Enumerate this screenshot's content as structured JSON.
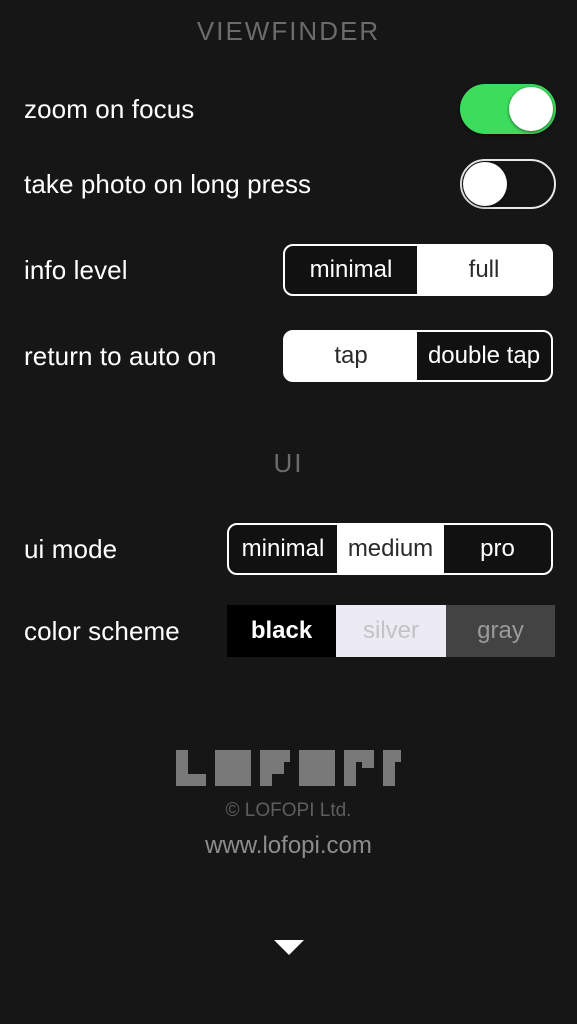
{
  "app": {
    "background_color": "#161616",
    "accent_on_color": "#3ddc5c"
  },
  "sections": [
    {
      "title": "VIEWFINDER"
    },
    {
      "title": "UI"
    }
  ],
  "viewfinder": {
    "header": "VIEWFINDER",
    "zoom_on_focus": {
      "label": "zoom on focus",
      "type": "toggle",
      "value": "on"
    },
    "take_photo_on_long_press": {
      "label": "take photo on long press",
      "type": "toggle",
      "value": "off"
    },
    "info_level": {
      "label": "info level",
      "type": "segmented",
      "options": [
        "minimal",
        "full"
      ],
      "selected": "minimal"
    },
    "return_to_auto_on": {
      "label": "return to auto on",
      "type": "segmented",
      "options": [
        "tap",
        "double tap"
      ],
      "selected": "double tap"
    }
  },
  "ui": {
    "header": "UI",
    "ui_mode": {
      "label": "ui mode",
      "type": "segmented",
      "options": [
        "minimal",
        "medium",
        "pro"
      ],
      "selected": "medium"
    },
    "color_scheme": {
      "label": "color scheme",
      "type": "swatches",
      "options": [
        {
          "name": "black",
          "color": "#000000",
          "text_color": "#ffffff"
        },
        {
          "name": "silver",
          "color": "#eceaf2",
          "text_color": "#c2c2c8"
        },
        {
          "name": "gray",
          "color": "#434343",
          "text_color": "#9a9a9a"
        }
      ],
      "selected": "black"
    }
  },
  "footer": {
    "logo_text": "LOFOPI",
    "copyright": "© LOFOPI Ltd.",
    "website": "www.lofopi.com",
    "scroll_down_icon": "chevron-down-icon"
  }
}
